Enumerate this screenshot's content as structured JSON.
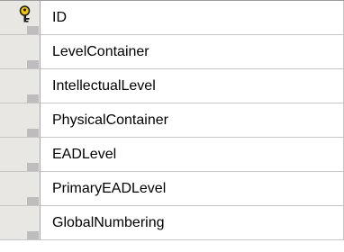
{
  "table": {
    "rows": [
      {
        "label": "ID",
        "primary_key": true
      },
      {
        "label": "LevelContainer",
        "primary_key": false
      },
      {
        "label": "IntellectualLevel",
        "primary_key": false
      },
      {
        "label": "PhysicalContainer",
        "primary_key": false
      },
      {
        "label": "EADLevel",
        "primary_key": false
      },
      {
        "label": "PrimaryEADLevel",
        "primary_key": false
      },
      {
        "label": "GlobalNumbering",
        "primary_key": false
      }
    ]
  },
  "icons": {
    "primary_key": "key-icon"
  },
  "colors": {
    "key_gold": "#f2c500",
    "selector_bg": "#e8e7e4",
    "gridline": "#c6c6c6"
  }
}
